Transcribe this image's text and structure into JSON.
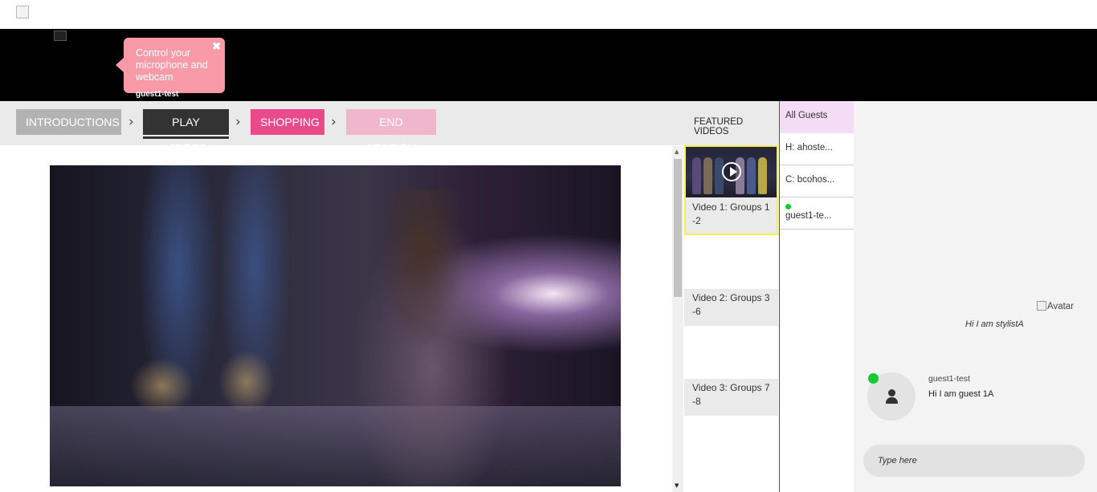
{
  "tooltip": {
    "text": "Control your microphone and webcam",
    "close": "✖"
  },
  "user": {
    "caption": "guest1-test"
  },
  "nav": {
    "steps": [
      {
        "label": "INTRODUCTIONS",
        "color": "#b3b3b3"
      },
      {
        "label": "PLAY VIDEOS",
        "color": "#333333"
      },
      {
        "label": "SHOPPING",
        "color": "#e94a8a"
      },
      {
        "label": "END SESSION",
        "color": "#f0b6cc"
      }
    ],
    "chevron": "›",
    "featured_label": "FEATURED VIDEOS"
  },
  "videos": [
    {
      "label": "Video 1: Groups 1 -2",
      "active": true
    },
    {
      "label": "Video 2: Groups 3 -6",
      "active": false
    },
    {
      "label": "Video 3: Groups 7 -8",
      "active": false
    }
  ],
  "guests": {
    "header": "All Guests",
    "rows": [
      {
        "label": "H: ahoste..."
      },
      {
        "label": "C: bcohos..."
      },
      {
        "label": "guest1-te...",
        "online": true
      }
    ]
  },
  "chat": {
    "avatar_alt": "Avatar",
    "stylist_message": "Hi I am stylistA",
    "guest_name": "guest1-test",
    "guest_message": "Hi I am guest 1A",
    "input_placeholder": "Type here"
  },
  "colors": {
    "accent_pink": "#e94a8a",
    "online_green": "#11cc33",
    "active_border": "#f4f050"
  }
}
